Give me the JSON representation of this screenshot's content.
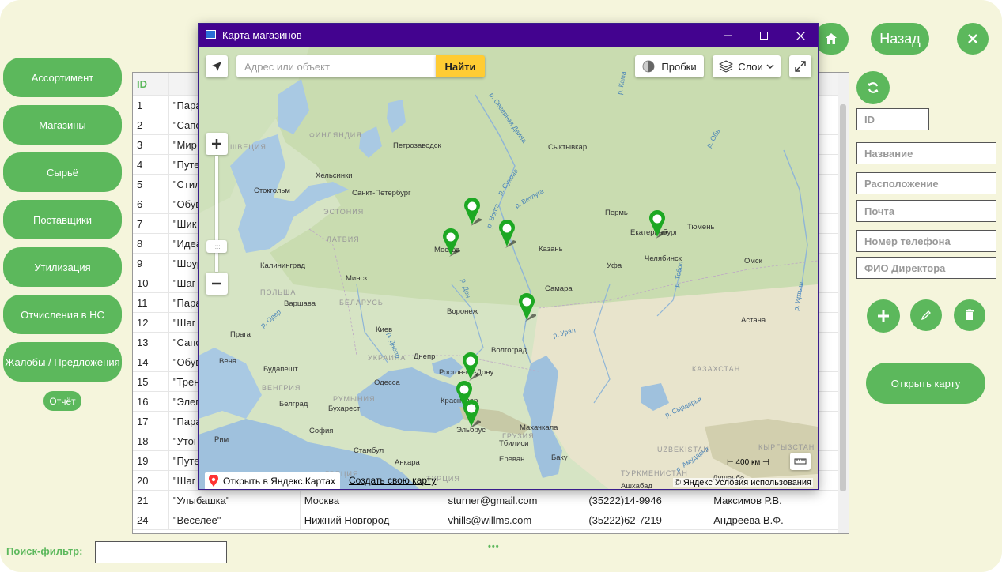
{
  "nav": {
    "items": [
      "Ассортимент",
      "Магазины",
      "Сырьё",
      "Поставщики",
      "Утилизация",
      "Отчисления в НС",
      "Жалобы / Предложения"
    ],
    "report": "Отчёт"
  },
  "header": {
    "back": "Назад"
  },
  "table": {
    "col_id": "ID",
    "rows": [
      {
        "id": "1",
        "name": "\"Пара"
      },
      {
        "id": "2",
        "name": "\"Сапо"
      },
      {
        "id": "3",
        "name": "\"Мир"
      },
      {
        "id": "4",
        "name": "\"Путе"
      },
      {
        "id": "5",
        "name": "\"Стил"
      },
      {
        "id": "6",
        "name": "\"Обув"
      },
      {
        "id": "7",
        "name": "\"Шик"
      },
      {
        "id": "8",
        "name": "\"Идеа"
      },
      {
        "id": "9",
        "name": "\"Шоур"
      },
      {
        "id": "10",
        "name": "\"Шаг"
      },
      {
        "id": "11",
        "name": "\"Пара"
      },
      {
        "id": "12",
        "name": "\"Шаг"
      },
      {
        "id": "13",
        "name": "\"Сапо"
      },
      {
        "id": "14",
        "name": "\"Обув"
      },
      {
        "id": "15",
        "name": "\"Трен"
      },
      {
        "id": "16",
        "name": "\"Элега"
      },
      {
        "id": "17",
        "name": "\"Пара"
      },
      {
        "id": "18",
        "name": "\"Утон"
      },
      {
        "id": "19",
        "name": "\"Путе"
      },
      {
        "id": "20",
        "name": "\"Шаг"
      }
    ],
    "full_rows": [
      {
        "id": "21",
        "name": "\"Улыбашка\"",
        "city": "Москва",
        "email": "sturner@gmail.com",
        "phone": "(35222)14-9946",
        "director": "Максимов Р.В."
      },
      {
        "id": "24",
        "name": "\"Веселее\"",
        "city": "Нижний Новгород",
        "email": "vhills@willms.com",
        "phone": "(35222)62-7219",
        "director": "Андреева В.Ф."
      }
    ]
  },
  "form": {
    "id": "ID",
    "name": "Название",
    "location": "Расположение",
    "mail": "Почта",
    "phone": "Номер телефона",
    "director": "ФИО Директора",
    "open_map": "Открыть карту"
  },
  "search": {
    "label": "Поиск-фильтр:",
    "value": ""
  },
  "map": {
    "window_title": "Карта магазинов",
    "search_placeholder": "Адрес или объект",
    "find": "Найти",
    "traffic": "Пробки",
    "layers": "Слои",
    "open_yandex": "Открыть в Яндекс.Картах",
    "create_map": "Создать свою карту",
    "copyright": "© Яндекс Условия использования",
    "scale": "400 км",
    "cities": [
      "Петрозаводск",
      "Сыктывкар",
      "Хельсинки",
      "Стокгольм",
      "Санкт-Петербург",
      "Пермь",
      "Екатеринбург",
      "Тюмень",
      "Москва",
      "Казань",
      "Челябинск",
      "Калининград",
      "Минск",
      "Уфа",
      "Омск",
      "Самара",
      "Варшава",
      "Воронеж",
      "Астана",
      "Киев",
      "Прага",
      "Днепр",
      "Волгоград",
      "Вена",
      "Будапешт",
      "Ростов-на-Дону",
      "Одесса",
      "Белград",
      "Бухарест",
      "Краснодар",
      "Махачкала",
      "Рим",
      "София",
      "Эльбрус",
      "Тбилиси",
      "Стамбул",
      "Ереван",
      "Баку",
      "Анкара",
      "Ашхабад",
      "Душанбе"
    ],
    "countries": [
      "ФИНЛЯНДИЯ",
      "ШВЕЦИЯ",
      "ЭСТОНИЯ",
      "ЛАТВИЯ",
      "БЕЛАРУСЬ",
      "ПОЛЬША",
      "УКРАИНА",
      "ВЕНГРИЯ",
      "РУМЫНИЯ",
      "ГРЕЦИЯ",
      "ТУРЦИЯ",
      "ГРУЗИЯ",
      "КАЗАХСТАН",
      "UZBEKISTAN",
      "КЫРГЫЗСТАН",
      "ТУРКМЕНИСТАН"
    ],
    "rivers": [
      "р. Северная Двина",
      "р. Сухона",
      "р. Ветлуга",
      "р. Волга",
      "р. Дон",
      "р. Урал",
      "р. Обь",
      "р. Тобол",
      "р. Днепр",
      "р. Одер",
      "р. Сырдарья",
      "р. Амударья",
      "р. Иртыш",
      "р. Кама"
    ]
  },
  "colors": {
    "accent": "#5cb85c",
    "titlebar": "#43038f",
    "background": "#f5f5dc"
  }
}
